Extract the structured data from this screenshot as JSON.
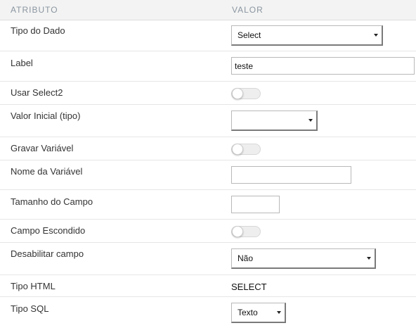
{
  "header": {
    "attribute": "ATRIBUTO",
    "value": "VALOR"
  },
  "rows": {
    "tipo_do_dado": {
      "label": "Tipo do Dado",
      "value": "Select"
    },
    "label": {
      "label": "Label",
      "value": "teste"
    },
    "usar_select2": {
      "label": "Usar Select2",
      "on": false
    },
    "valor_inicial": {
      "label": "Valor Inicial (tipo)",
      "value": ""
    },
    "gravar_variavel": {
      "label": "Gravar Variável",
      "on": false
    },
    "nome_variavel": {
      "label": "Nome da Variável",
      "value": ""
    },
    "tamanho_campo": {
      "label": "Tamanho do Campo",
      "value": ""
    },
    "campo_escondido": {
      "label": "Campo Escondido",
      "on": false
    },
    "desabilitar_campo": {
      "label": "Desabilitar campo",
      "value": "Não"
    },
    "tipo_html": {
      "label": "Tipo HTML",
      "value": "SELECT"
    },
    "tipo_sql": {
      "label": "Tipo SQL",
      "value": "Texto"
    }
  }
}
